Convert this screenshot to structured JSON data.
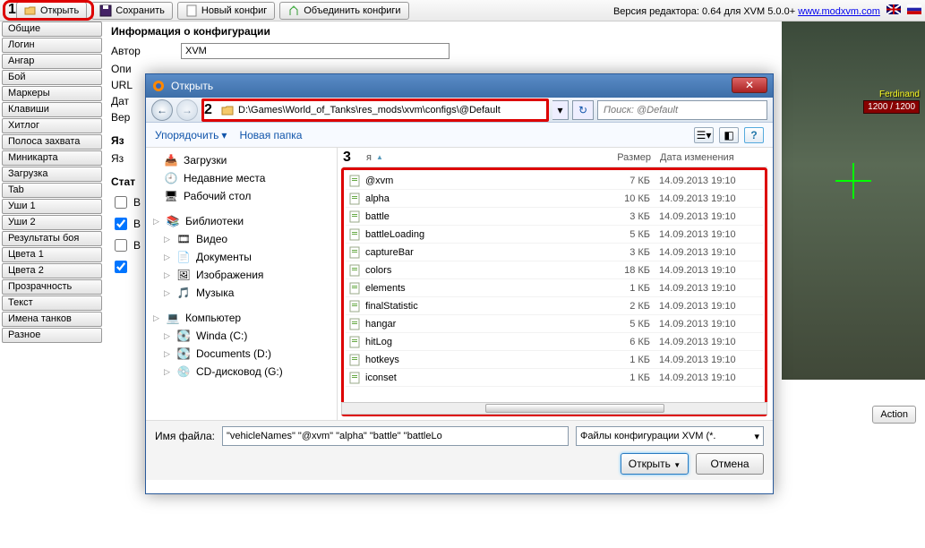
{
  "topbar": {
    "open": "Открыть",
    "save": "Сохранить",
    "new": "Новый конфиг",
    "merge": "Объединить конфиги",
    "version_prefix": "Версия редактора: 0.64 для XVM 5.0.0+ ",
    "link": "www.modxvm.com"
  },
  "sidebar": {
    "items": [
      "Общие",
      "Логин",
      "Ангар",
      "Бой",
      "Маркеры",
      "Клавиши",
      "Хитлог",
      "Полоса захвата",
      "Миникарта",
      "Загрузка",
      "Tab",
      "Уши 1",
      "Уши 2",
      "Результаты боя",
      "Цвета 1",
      "Цвета 2",
      "Прозрачность",
      "Текст",
      "Имена танков",
      "Разное"
    ]
  },
  "info": {
    "title": "Информация о конфигурации",
    "author_lbl": "Автор",
    "author_val": "XVM",
    "desc_lbl": "Опи",
    "url_lbl": "URL",
    "date_lbl": "Дат",
    "ver_lbl": "Вер",
    "lang_sect": "Яз",
    "lang_lbl": "Яз",
    "stat_sect": "Стат",
    "cb1": "В",
    "cb2": "В",
    "cb3": "В"
  },
  "game": {
    "tank": "Ferdinand",
    "hp": "1200 / 1200",
    "action": "Action"
  },
  "dialog": {
    "title": "Открыть",
    "path": "D:\\Games\\World_of_Tanks\\res_mods\\xvm\\configs\\@Default",
    "search_placeholder": "Поиск: @Default",
    "organize": "Упорядочить",
    "newfolder": "Новая папка",
    "tree": {
      "downloads": "Загрузки",
      "recent": "Недавние места",
      "desktop": "Рабочий стол",
      "libraries": "Библиотеки",
      "video": "Видео",
      "documents": "Документы",
      "pictures": "Изображения",
      "music": "Музыка",
      "computer": "Компьютер",
      "drive_c": "Winda (C:)",
      "drive_d": "Documents (D:)",
      "drive_g": "CD-дисковод (G:)"
    },
    "columns": {
      "name": "я",
      "size": "Размер",
      "date": "Дата изменения"
    },
    "files": [
      {
        "name": "@xvm",
        "size": "7 КБ",
        "date": "14.09.2013 19:10"
      },
      {
        "name": "alpha",
        "size": "10 КБ",
        "date": "14.09.2013 19:10"
      },
      {
        "name": "battle",
        "size": "3 КБ",
        "date": "14.09.2013 19:10"
      },
      {
        "name": "battleLoading",
        "size": "5 КБ",
        "date": "14.09.2013 19:10"
      },
      {
        "name": "captureBar",
        "size": "3 КБ",
        "date": "14.09.2013 19:10"
      },
      {
        "name": "colors",
        "size": "18 КБ",
        "date": "14.09.2013 19:10"
      },
      {
        "name": "elements",
        "size": "1 КБ",
        "date": "14.09.2013 19:10"
      },
      {
        "name": "finalStatistic",
        "size": "2 КБ",
        "date": "14.09.2013 19:10"
      },
      {
        "name": "hangar",
        "size": "5 КБ",
        "date": "14.09.2013 19:10"
      },
      {
        "name": "hitLog",
        "size": "6 КБ",
        "date": "14.09.2013 19:10"
      },
      {
        "name": "hotkeys",
        "size": "1 КБ",
        "date": "14.09.2013 19:10"
      },
      {
        "name": "iconset",
        "size": "1 КБ",
        "date": "14.09.2013 19:10"
      }
    ],
    "filename_lbl": "Имя файла:",
    "filename_val": "\"vehicleNames\" \"@xvm\" \"alpha\" \"battle\" \"battleLo",
    "filetype": "Файлы конфигурации XVM (*.",
    "open_btn": "Открыть",
    "cancel_btn": "Отмена"
  }
}
